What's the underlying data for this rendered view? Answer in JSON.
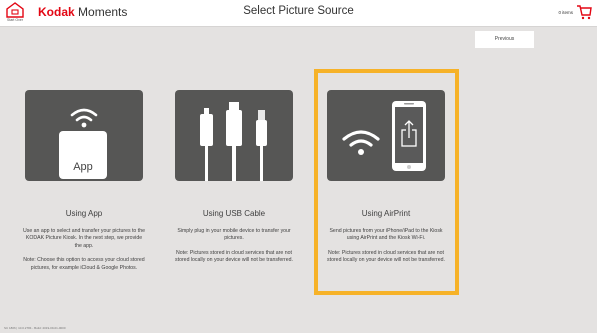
{
  "header": {
    "home_label": "Start Over",
    "brand_bold": "Kodak",
    "brand_rest": " Moments",
    "title": "Select Picture Source",
    "cart_count": "0 items"
  },
  "previous_label": "Previous",
  "options": [
    {
      "icon": "app-icon",
      "icon_text": "App",
      "title": "Using App",
      "description": "Use an app to select and transfer your pictures to the KODAK Picture Kiosk. In the next step, we provide the app.",
      "note": "Note: Choose this option to access your cloud stored pictures, for example iCloud & Google Photos."
    },
    {
      "icon": "usb-cable-icon",
      "title": "Using USB Cable",
      "description": "Simply plug in your mobile device to transfer your pictures.",
      "note": "Note: Pictures stored in cloud services that are not stored locally on your device will not be transferred."
    },
    {
      "icon": "airprint-icon",
      "title": "Using AirPrint",
      "description": "Send pictures from your iPhone/iPad to the Kiosk using AirPrint and the Kiosk Wi-Fi.",
      "note": "Note: Pictures stored in cloud services that are not stored locally on your device will not be transferred."
    }
  ],
  "footer": "SC 1806 | 10.0.2784 - Build: 2019-09-01-0000",
  "colors": {
    "brand": "#e30613",
    "highlight": "#f6b228",
    "tile": "#565655",
    "background": "#e4e2e1"
  }
}
